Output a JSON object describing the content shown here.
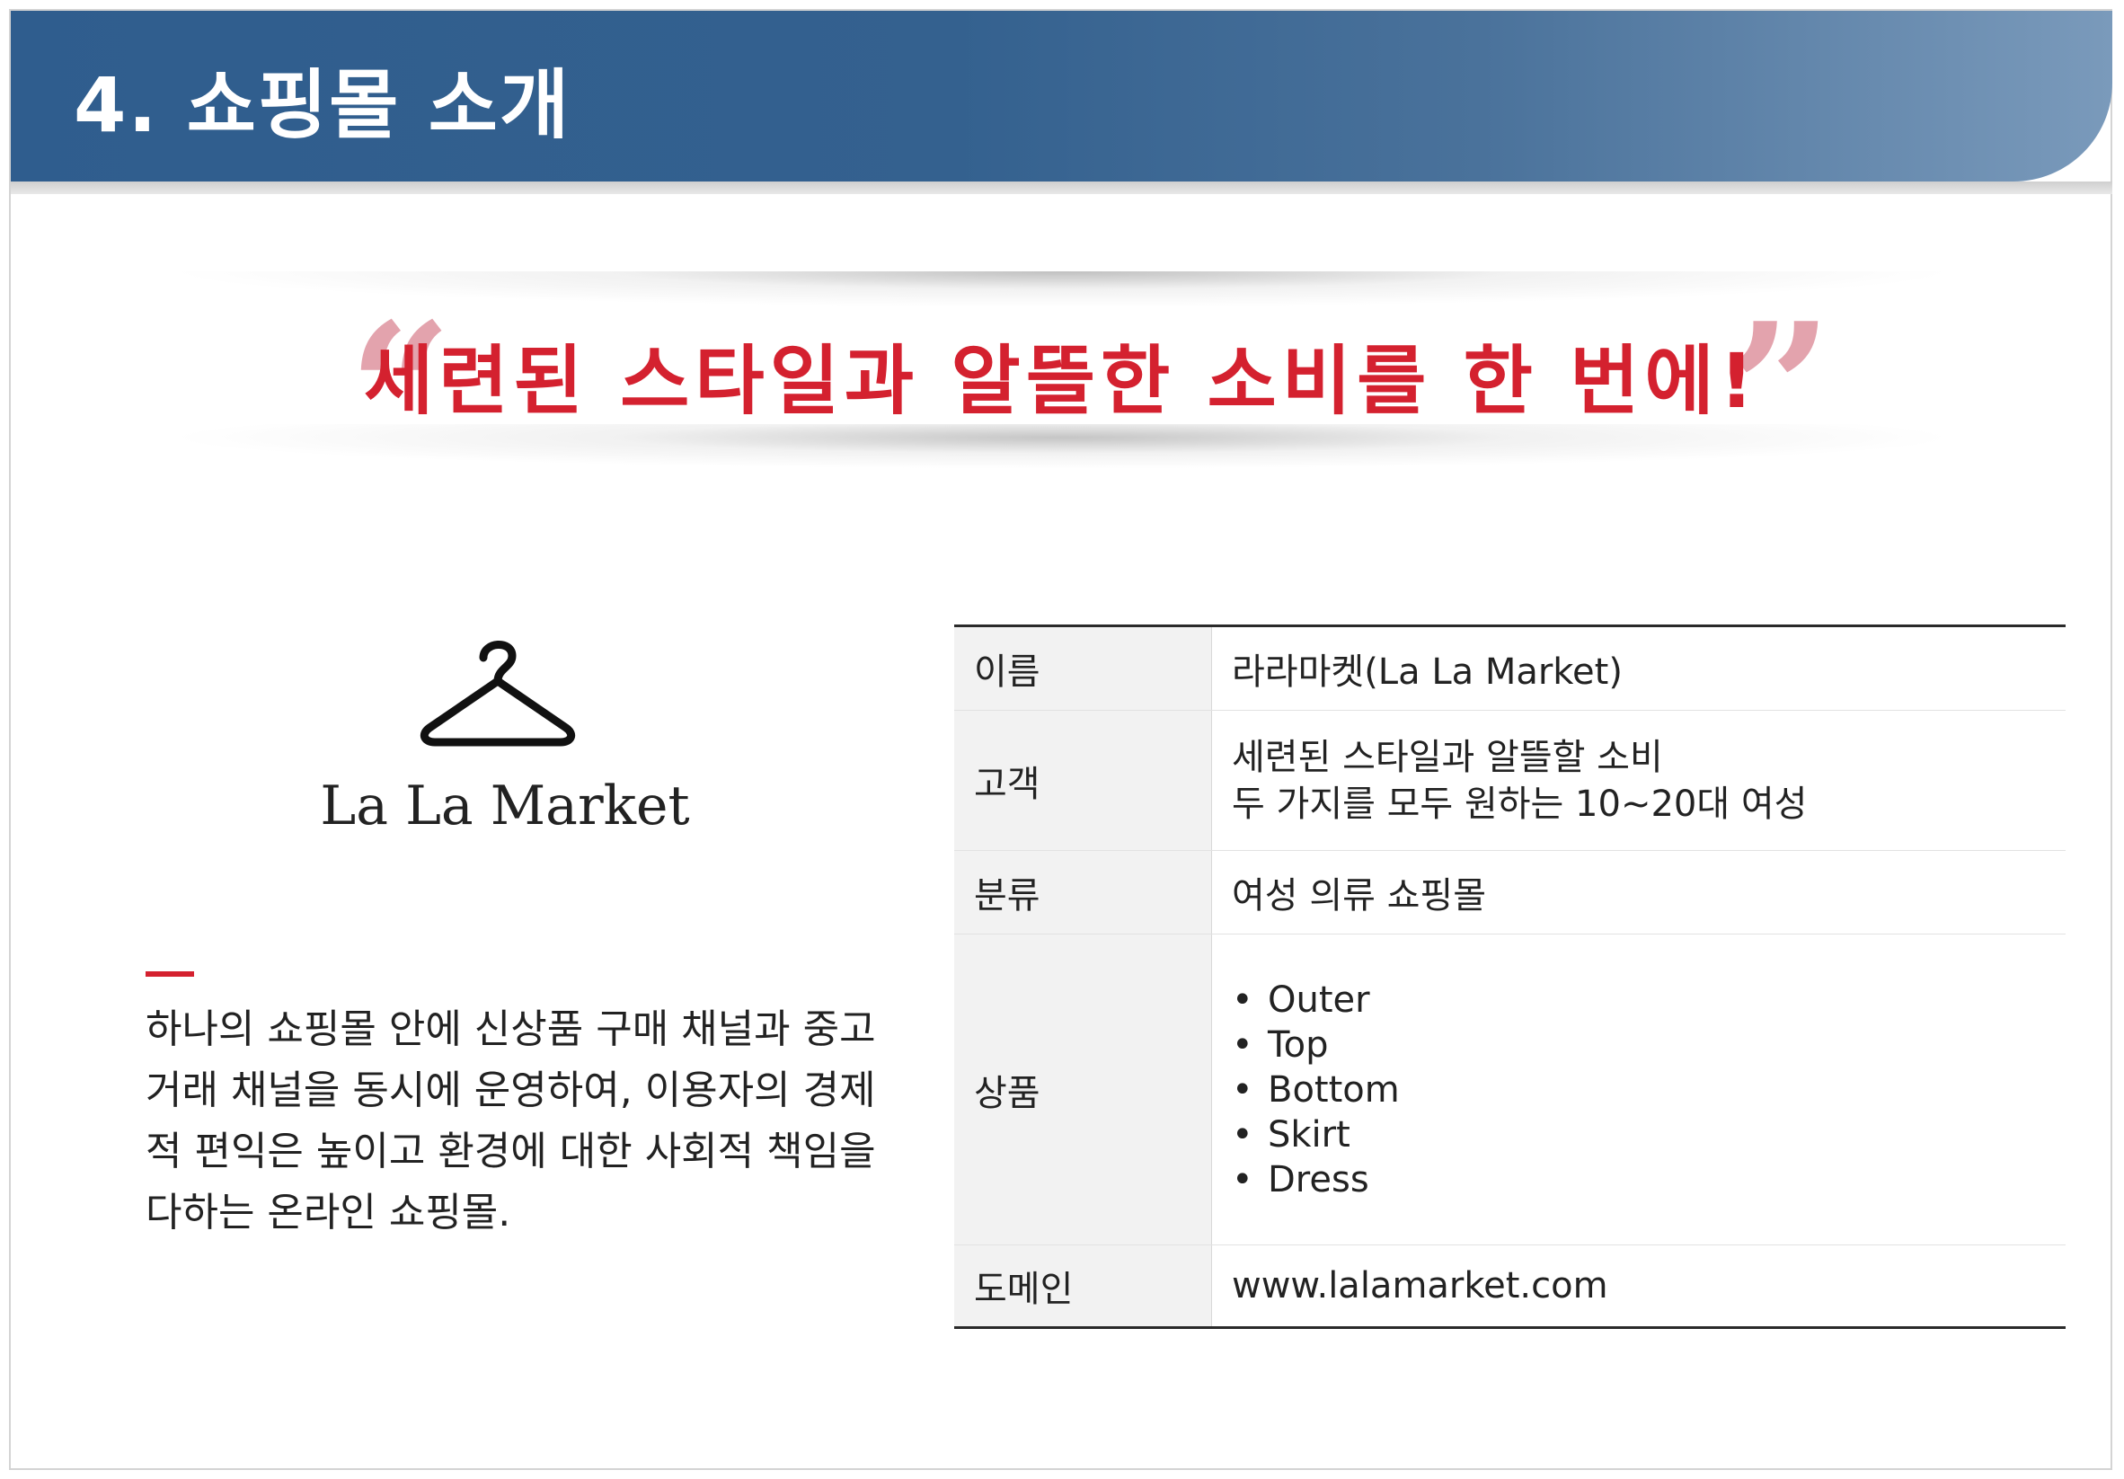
{
  "header": {
    "title": "4. 쇼핑몰 소개"
  },
  "slogan": {
    "text": "세련된 스타일과 알뜰한 소비를 한 번에!",
    "open_quote": "“",
    "close_quote": "”",
    "color": "#d4212f"
  },
  "logo": {
    "icon": "hanger-icon",
    "name": "La La Market"
  },
  "description": {
    "text": "하나의 쇼핑몰 안에 신상품 구매 채널과 중고 거래 채널을 동시에 운영하여, 이용자의 경제적 편익은 높이고 환경에 대한 사회적 책임을 다하는 온라인 쇼핑몰."
  },
  "table": {
    "rows": [
      {
        "key": "이름",
        "value": "라라마켓(La La Market)"
      },
      {
        "key": "고객",
        "lines": [
          "세련된 스타일과 알뜰할 소비",
          "두 가지를 모두 원하는 10~20대 여성"
        ]
      },
      {
        "key": "분류",
        "value": "여성 의류 쇼핑몰"
      },
      {
        "key": "상품",
        "items": [
          "Outer",
          "Top",
          "Bottom",
          "Skirt",
          "Dress"
        ]
      },
      {
        "key": "도메인",
        "value": "www.lalamarket.com"
      }
    ]
  },
  "colors": {
    "header_blue": "#2f5d8e",
    "accent_red": "#d4212f"
  }
}
